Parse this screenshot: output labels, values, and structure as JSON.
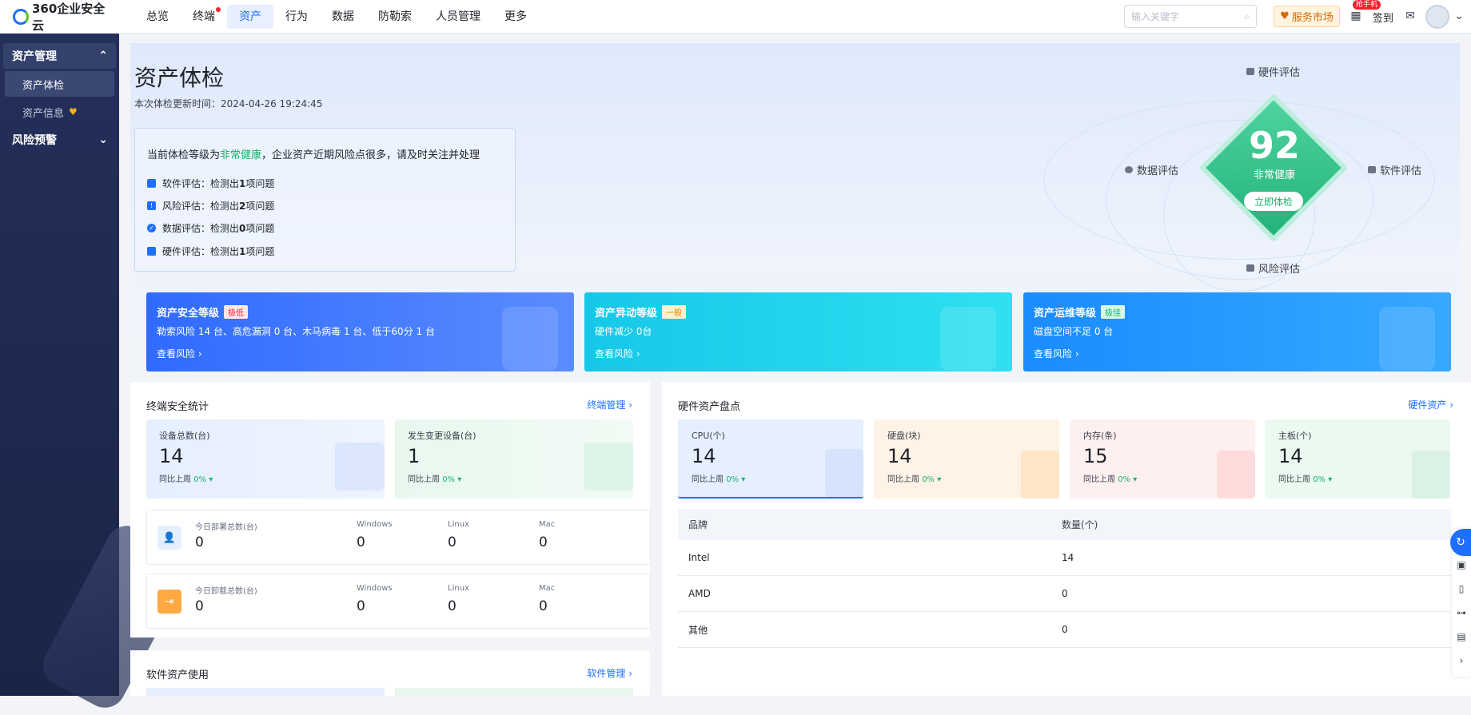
{
  "app": {
    "logo": "360企业安全云"
  },
  "nav": [
    "总览",
    "终端",
    "资产",
    "行为",
    "数据",
    "防勒索",
    "人员管理",
    "更多"
  ],
  "search": {
    "placeholder": "输入关键字"
  },
  "topbar": {
    "market": "服务市场",
    "checkin": "签到",
    "tag": "抢手机"
  },
  "sidebar": {
    "group1": "资产管理",
    "items": [
      "资产体检",
      "资产信息"
    ],
    "group2": "风险预警"
  },
  "hero": {
    "title": "资产体检",
    "updated": "本次体检更新时间：2024-04-26 19:24:45",
    "lead_prefix": "当前体检等级为",
    "lead_level": "非常健康",
    "lead_suffix": "，企业资产近期风险点很多，请及时关注并处理",
    "rows": [
      {
        "label": "软件评估：检测出 ",
        "count": "1",
        "unit": " 项问题"
      },
      {
        "label": "风险评估：检测出 ",
        "count": "2",
        "unit": " 项问题"
      },
      {
        "label": "数据评估：检测出 ",
        "count": "0",
        "unit": " 项问题"
      },
      {
        "label": "硬件评估：检测出 ",
        "count": "1",
        "unit": " 项问题"
      }
    ],
    "score": "92",
    "score_label": "非常健康",
    "check_btn": "立即体检",
    "dims": {
      "top": "硬件评估",
      "left": "数据评估",
      "right": "软件评估",
      "bottom": "风险评估"
    }
  },
  "cards": [
    {
      "title": "资产安全等级",
      "badge": "极低",
      "desc": "勒索风险 14 台、高危漏洞 0 台、木马病毒 1 台、低于60分 1 台",
      "link": "查看风险 ›",
      "color": "#2f6bff",
      "badge_bg": "#ffe8e8",
      "badge_color": "#f5222d"
    },
    {
      "title": "资产异动等级",
      "badge": "一般",
      "desc": "硬件减少 0台",
      "link": "查看风险 ›",
      "color": "#16c8e8",
      "badge_bg": "#fff1cc",
      "badge_color": "#d48806"
    },
    {
      "title": "资产运维等级",
      "badge": "极佳",
      "desc": "磁盘空间不足 0 台",
      "link": "查看风险 ›",
      "color": "#1a8cff",
      "badge_bg": "#d9f7e6",
      "badge_color": "#17b26a"
    }
  ],
  "endpoint": {
    "title": "终端安全统计",
    "link": "终端管理 ›",
    "stats": [
      {
        "title": "设备总数(台)",
        "value": "14",
        "compare": "同比上周",
        "pct": "0% ▾"
      },
      {
        "title": "发生变更设备(台)",
        "value": "1",
        "compare": "同比上周",
        "pct": "0% ▾"
      }
    ],
    "rows": [
      {
        "title": "今日部署总数(台)",
        "value": "0",
        "windows": "0",
        "linux": "0",
        "mac": "0"
      },
      {
        "title": "今日卸载总数(台)",
        "value": "0",
        "windows": "0",
        "linux": "0",
        "mac": "0"
      }
    ],
    "os_labels": [
      "Windows",
      "Linux",
      "Mac"
    ]
  },
  "software": {
    "title": "软件资产使用",
    "link": "软件管理 ›"
  },
  "hardware": {
    "title": "硬件资产盘点",
    "link": "硬件资产 ›",
    "stats": [
      {
        "title": "CPU(个)",
        "value": "14",
        "compare": "同比上周",
        "pct": "0% ▾"
      },
      {
        "title": "硬盘(块)",
        "value": "14",
        "compare": "同比上周",
        "pct": "0% ▾"
      },
      {
        "title": "内存(条)",
        "value": "15",
        "compare": "同比上周",
        "pct": "0% ▾"
      },
      {
        "title": "主板(个)",
        "value": "14",
        "compare": "同比上周",
        "pct": "0% ▾"
      }
    ],
    "table": {
      "headers": [
        "品牌",
        "数量(个)"
      ],
      "rows": [
        [
          "Intel",
          "14"
        ],
        [
          "AMD",
          "0"
        ],
        [
          "其他",
          "0"
        ]
      ]
    }
  }
}
